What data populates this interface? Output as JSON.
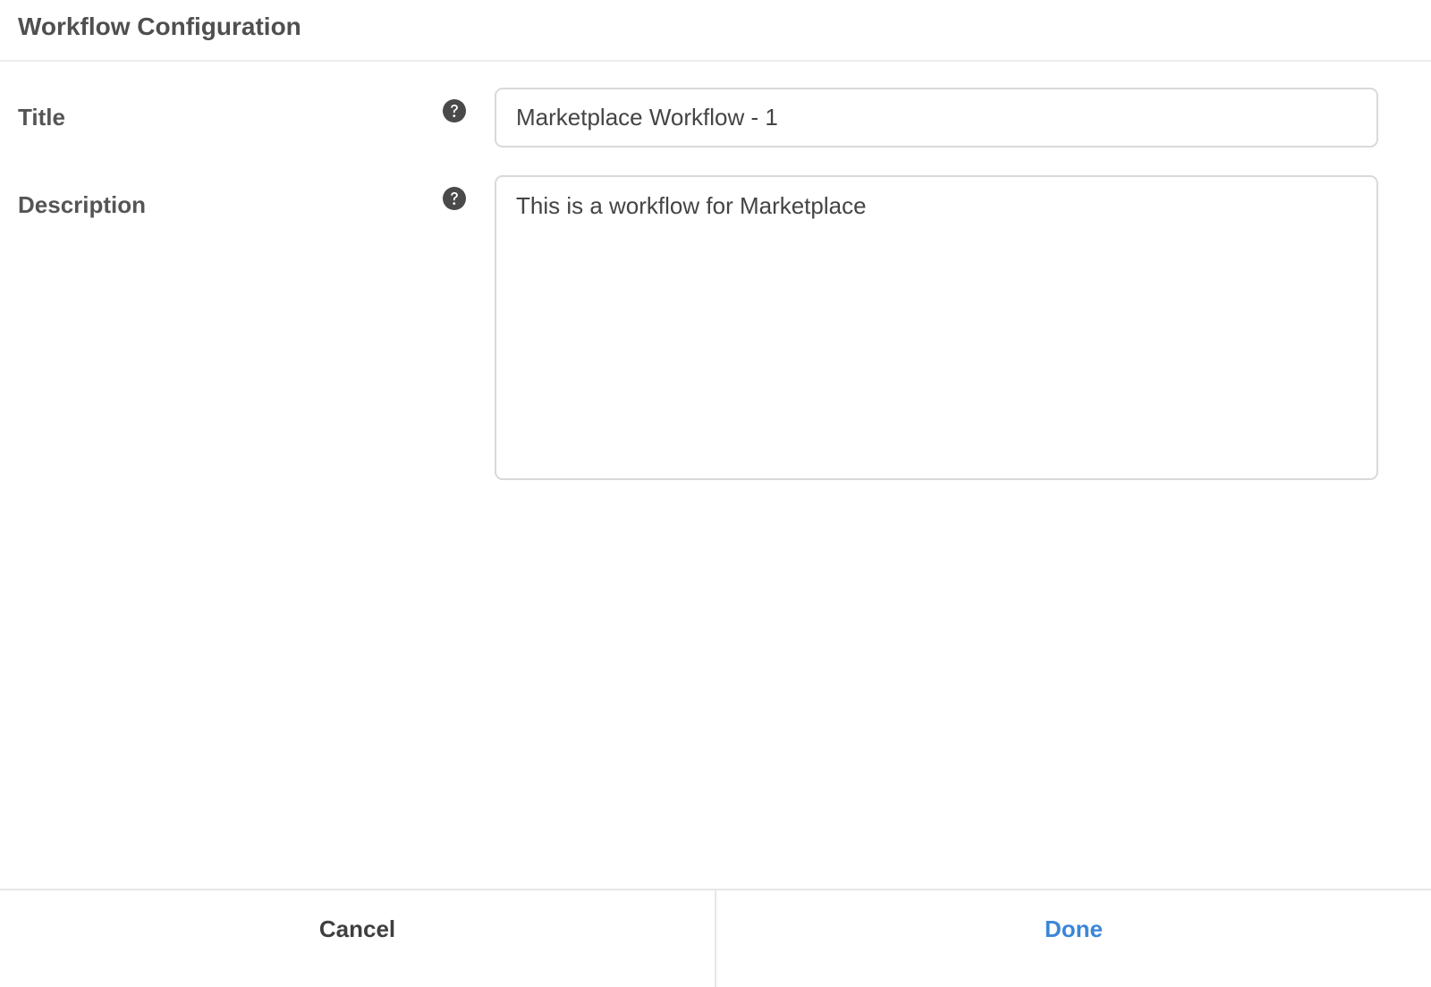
{
  "dialog": {
    "title": "Workflow Configuration"
  },
  "form": {
    "title_field": {
      "label": "Title",
      "value": "Marketplace Workflow - 1",
      "help_icon": "question-circle-icon"
    },
    "description_field": {
      "label": "Description",
      "value": "This is a workflow for Marketplace",
      "help_icon": "question-circle-icon"
    }
  },
  "footer": {
    "cancel_label": "Cancel",
    "done_label": "Done"
  },
  "colors": {
    "accent": "#3b86d8",
    "text": "#4a4a4a",
    "border": "#d9d9d9"
  }
}
